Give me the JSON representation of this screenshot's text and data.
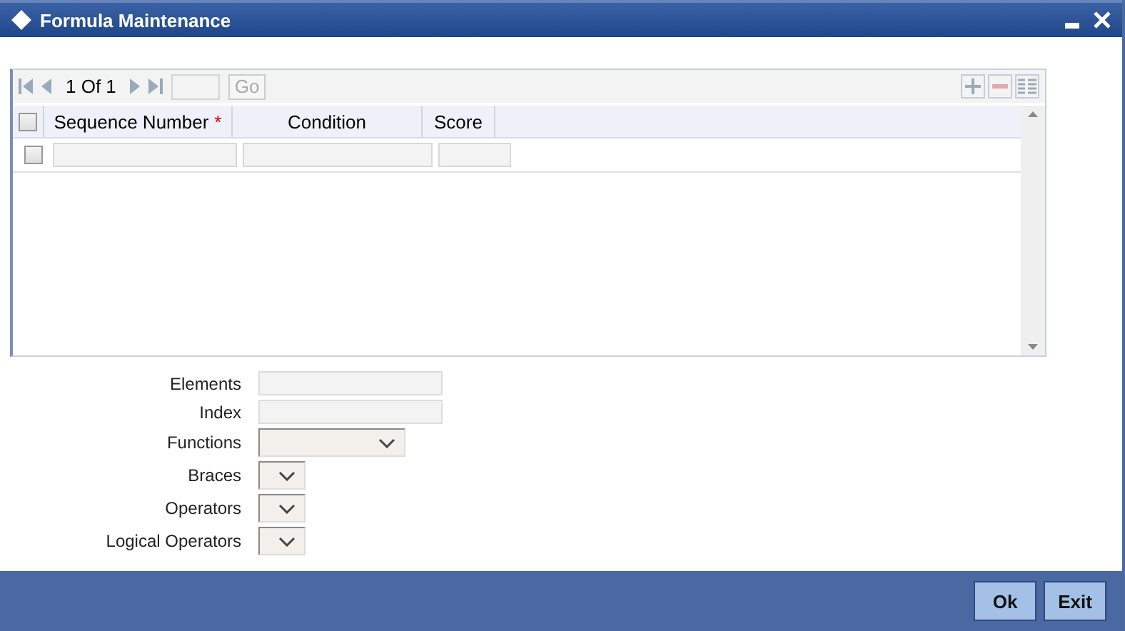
{
  "window": {
    "title": "Formula Maintenance"
  },
  "pager": {
    "text": "1 Of 1",
    "go": "Go"
  },
  "table": {
    "select_all": {
      "checked": false
    },
    "columns": [
      {
        "label": "Sequence Number",
        "mark": "*"
      },
      {
        "label": "Condition"
      },
      {
        "label": "Score"
      }
    ],
    "rows": [
      {
        "checked": false
      }
    ]
  },
  "form": [
    {
      "label": "Elements",
      "kind": "text"
    },
    {
      "label": "Index",
      "kind": "text"
    },
    {
      "label": "Functions",
      "kind": "select"
    },
    {
      "label": "Braces",
      "kind": "picker"
    },
    {
      "label": "Operators",
      "kind": "picker"
    },
    {
      "label": "Logical Operators",
      "kind": "picker"
    }
  ],
  "buttons": [
    "Ok",
    "Exit"
  ]
}
